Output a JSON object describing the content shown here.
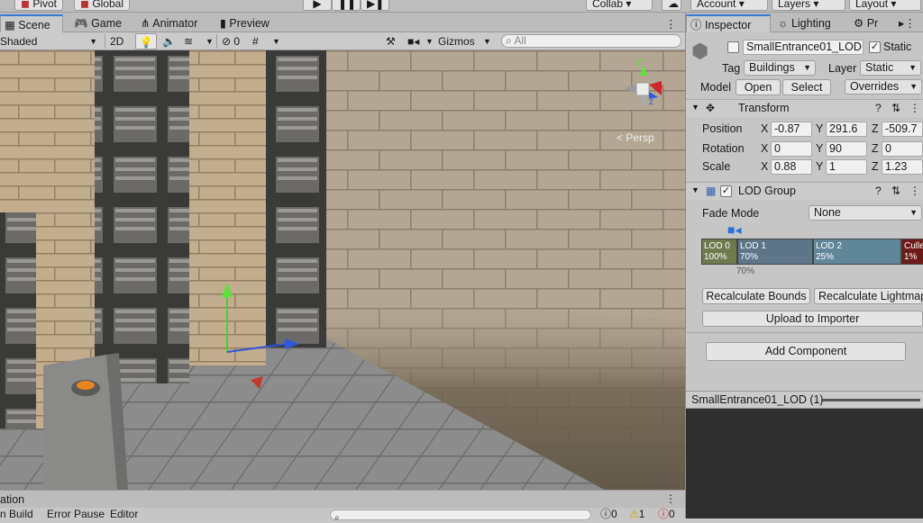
{
  "toolbar": {
    "pivot_label": "Pivot",
    "global_label": "Global",
    "play_icon": "play-icon",
    "pause_icon": "pause-icon",
    "step_icon": "step-icon",
    "collab_label": "Collab",
    "account_label": "Account",
    "layers_label": "Layers",
    "layout_label": "Layout"
  },
  "scene_tabs": [
    {
      "label": "Scene",
      "icon": "scene-icon"
    },
    {
      "label": "Game",
      "icon": "game-icon"
    },
    {
      "label": "Animator",
      "icon": "animator-icon"
    },
    {
      "label": "Preview",
      "icon": "preview-icon"
    }
  ],
  "scene_toolbar": {
    "shading_mode": "Shaded",
    "mode_2d": "2D",
    "hidden_count": "0",
    "gizmos_label": "Gizmos",
    "search_placeholder": "All"
  },
  "viewport": {
    "persp_label": "< Persp",
    "axis_y": "y",
    "axis_x": "x",
    "axis_z": "z"
  },
  "console": {
    "tab_label": "ation",
    "clear_on_build": "n Build",
    "error_pause": "Error Pause",
    "editor_label": "Editor",
    "count_messages": "0",
    "count_warnings": "1",
    "count_errors": "0"
  },
  "inspector": {
    "tabs": [
      {
        "label": "Inspector",
        "icon": "info-icon"
      },
      {
        "label": "Lighting",
        "icon": "lighting-icon"
      },
      {
        "label": "Pr",
        "icon": "gear-icon"
      }
    ],
    "object_name": "SmallEntrance01_LOD",
    "static_label": "Static",
    "tag_label": "Tag",
    "tag_value": "Buildings",
    "layer_label": "Layer",
    "layer_value": "Static",
    "model_label": "Model",
    "open_label": "Open",
    "select_label": "Select",
    "overrides_label": "Overrides",
    "transform": {
      "title": "Transform",
      "position_label": "Position",
      "rotation_label": "Rotation",
      "scale_label": "Scale",
      "position": {
        "x": "-0.87",
        "y": "291.6",
        "z": "-509.7"
      },
      "rotation": {
        "x": "0",
        "y": "90",
        "z": "0"
      },
      "scale": {
        "x": "0.88",
        "y": "1",
        "z": "1.23"
      }
    },
    "lod_group": {
      "title": "LOD Group",
      "fade_mode_label": "Fade Mode",
      "fade_mode_value": "None",
      "levels": [
        {
          "name": "LOD 0",
          "percent": "100%",
          "color": "#6d7a4c"
        },
        {
          "name": "LOD 1",
          "percent": "70%",
          "color": "#5f7588"
        },
        {
          "name": "LOD 2",
          "percent": "25%",
          "color": "#5f8797"
        },
        {
          "name": "Culle",
          "percent": "1%",
          "color": "#6e1a1a"
        }
      ],
      "marker_label": "70%",
      "recalc_bounds": "Recalculate Bounds",
      "recalc_lightmap": "Recalculate Lightmap",
      "upload_importer": "Upload to Importer"
    },
    "add_component": "Add Component",
    "preview_title": "SmallEntrance01_LOD (1)"
  }
}
